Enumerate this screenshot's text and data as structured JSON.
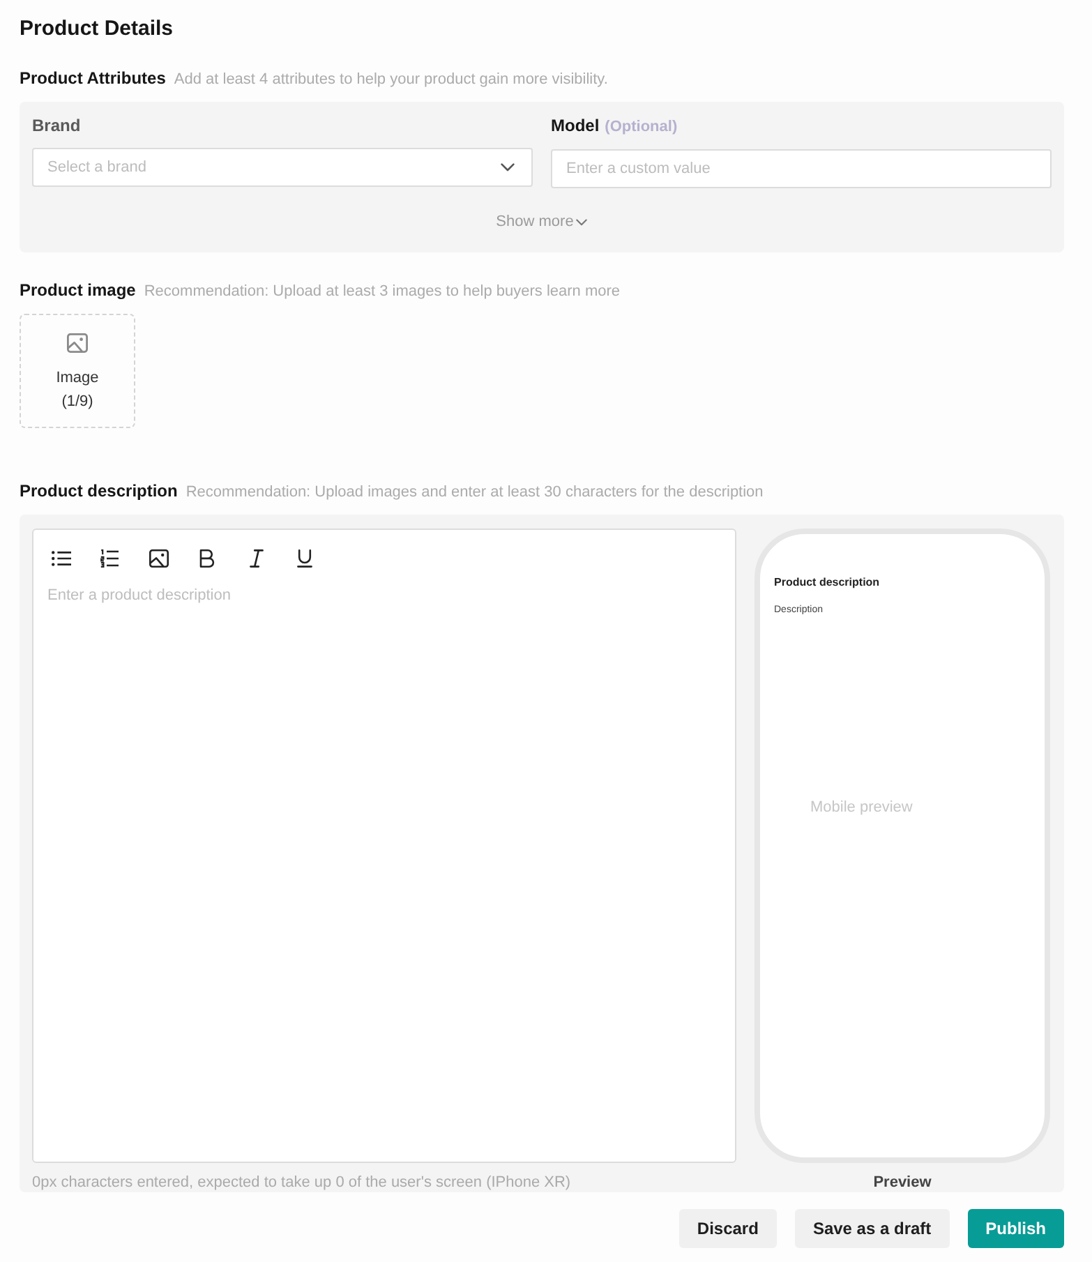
{
  "page": {
    "title": "Product Details"
  },
  "attributes": {
    "label": "Product Attributes",
    "hint": "Add at least 4 attributes to help your product gain more visibility.",
    "fields": [
      {
        "kind": "select",
        "label": "Brand",
        "placeholder": "Select a brand"
      },
      {
        "kind": "input",
        "label": "Model",
        "note": "(Optional)",
        "placeholder": "Enter a custom value"
      }
    ],
    "show_more": "Show more"
  },
  "image": {
    "label": "Product image",
    "hint": "Recommendation: Upload at least 3 images to help buyers learn more",
    "upload": {
      "label": "Image",
      "count": "(1/9)"
    }
  },
  "description": {
    "label": "Product description",
    "hint": "Recommendation: Upload images and enter at least 30 characters for the description",
    "editor": {
      "placeholder": "Enter a product description"
    },
    "counter": "0px characters entered, expected to take up 0 of the user's screen (IPhone XR)",
    "preview": {
      "heading": "Product description",
      "subheading": "Description",
      "caption": "Mobile preview",
      "label": "Preview"
    }
  },
  "actions": [
    {
      "kind": "secondary",
      "label": "Discard"
    },
    {
      "kind": "secondary",
      "label": "Save as a draft"
    },
    {
      "kind": "primary",
      "label": "Publish"
    }
  ]
}
